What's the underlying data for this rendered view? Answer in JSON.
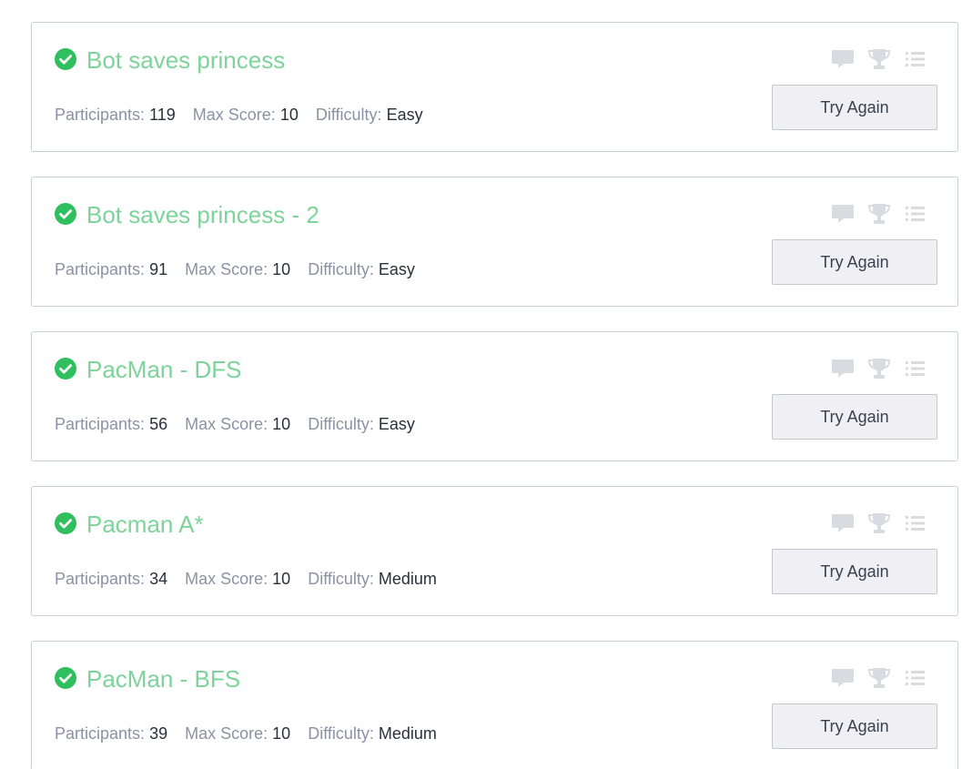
{
  "colors": {
    "solved_check": "#2fbf5e",
    "title": "#7dd49a",
    "label": "#8a93a3",
    "value": "#2a2f3a",
    "icon": "#d9dbe1"
  },
  "labels": {
    "participants": "Participants:",
    "max_score": "Max Score:",
    "difficulty": "Difficulty:",
    "try_again": "Try Again"
  },
  "challenges": [
    {
      "title": "Bot saves princess",
      "participants": "119",
      "max_score": "10",
      "difficulty": "Easy",
      "solved": true
    },
    {
      "title": "Bot saves princess - 2",
      "participants": "91",
      "max_score": "10",
      "difficulty": "Easy",
      "solved": true
    },
    {
      "title": "PacMan - DFS",
      "participants": "56",
      "max_score": "10",
      "difficulty": "Easy",
      "solved": true
    },
    {
      "title": "Pacman A*",
      "participants": "34",
      "max_score": "10",
      "difficulty": "Medium",
      "solved": true
    },
    {
      "title": "PacMan - BFS",
      "participants": "39",
      "max_score": "10",
      "difficulty": "Medium",
      "solved": true
    }
  ],
  "icons": [
    "check-circle-icon",
    "comment-icon",
    "trophy-icon",
    "list-icon"
  ]
}
